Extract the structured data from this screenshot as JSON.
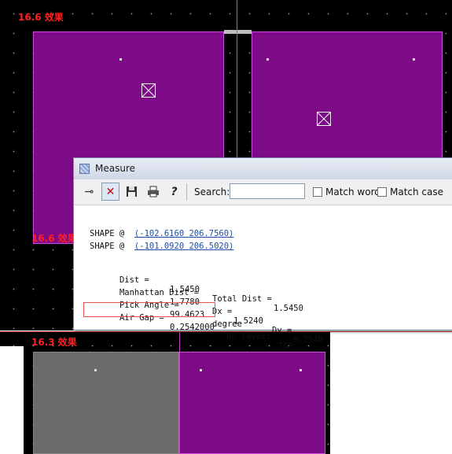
{
  "top_panel": {
    "caption": "16.6 效果"
  },
  "bottom_panel": {
    "caption": "16.3 效果"
  },
  "measure_window": {
    "title": "Measure",
    "toolbar": {
      "icons": [
        "pin-icon",
        "close-icon",
        "save-icon",
        "print-icon",
        "help-icon"
      ],
      "search_label": "Search:",
      "search_value": "",
      "match_word_label": "Match word",
      "match_word_checked": false,
      "match_case_label": "Match case",
      "match_case_checked": false
    },
    "shape1": {
      "label": "SHAPE @",
      "coords": "(-102.6160 206.7560)"
    },
    "shape2": {
      "label": "SHAPE @",
      "coords": "(-101.0920 206.5020)"
    },
    "dist": {
      "label": "Dist =",
      "value": "1.5450",
      "total_label": "Total Dist =",
      "total_value": "1.5450"
    },
    "manhattan": {
      "label": "Manhattan Dist =",
      "value": "1.7780",
      "dx_label": "Dx =",
      "dx_value": "1.5240",
      "dy_label": "Dy =",
      "dy_value": "0.2540"
    },
    "pick_angle": {
      "label": "Pick Angle =",
      "value": "99.4623",
      "unit": "degree"
    },
    "air_gap": {
      "label": "Air Gap =",
      "value": "0.2542000",
      "layer_label": "On layer:",
      "layer_value": "TOP"
    }
  },
  "colors": {
    "pad": "#7d0a86",
    "pad_border": "#d24be0",
    "highlight": "#e25555",
    "caption": "#ff2020"
  }
}
